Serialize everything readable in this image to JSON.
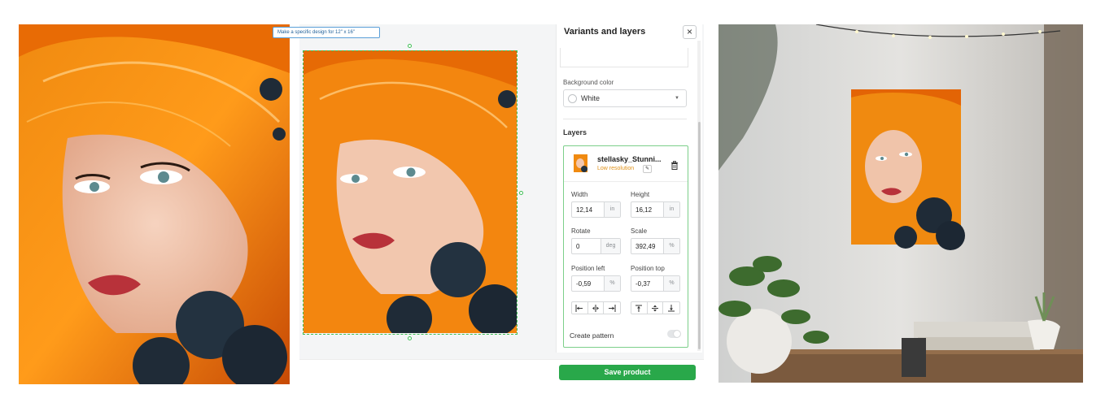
{
  "panel": {
    "title": "Variants and layers",
    "close_icon": "close-icon",
    "spec_link": "Make a specific design for 12\" x 16\"",
    "background_label": "Background color",
    "background_value": "White",
    "layers_title": "Layers"
  },
  "layer": {
    "name": "stellasky_Stunni...",
    "warning": "Low resolution",
    "width_label": "Width",
    "width_value": "12,14",
    "width_unit": "in",
    "height_label": "Height",
    "height_value": "16,12",
    "height_unit": "in",
    "rotate_label": "Rotate",
    "rotate_value": "0",
    "rotate_unit": "deg",
    "scale_label": "Scale",
    "scale_value": "392,49",
    "scale_unit": "%",
    "pos_left_label": "Position left",
    "pos_left_value": "-0,59",
    "pos_left_unit": "%",
    "pos_top_label": "Position top",
    "pos_top_value": "-0,37",
    "pos_top_unit": "%",
    "pattern_label": "Create pattern",
    "pattern_enabled": false
  },
  "actions": {
    "save_label": "Save product"
  },
  "colors": {
    "accent": "#29a84a",
    "selection": "#3fbf55",
    "warning": "#e0921a",
    "link": "#1f5f99"
  },
  "icons": [
    "close-icon",
    "chevron-down-icon",
    "trash-icon",
    "enhance-icon",
    "align-left-icon",
    "align-center-h-icon",
    "align-right-icon",
    "align-top-icon",
    "align-center-v-icon",
    "align-bottom-icon"
  ]
}
